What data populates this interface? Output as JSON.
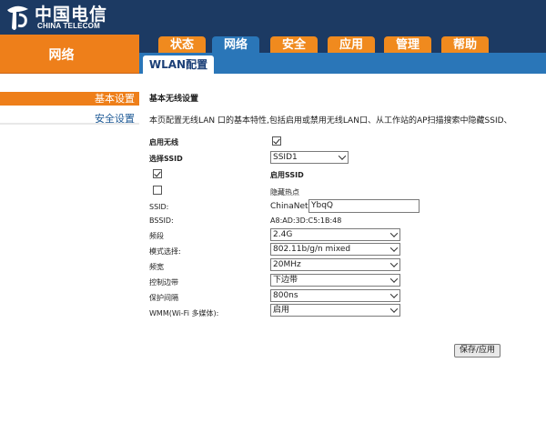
{
  "brand": {
    "name_cn": "中国电信",
    "name_en": "CHINA TELECOM",
    "colors": {
      "header_bg": "#1c3a63",
      "accent_orange": "#ee7f1a",
      "tab_blue": "#2a76b8"
    }
  },
  "nav": {
    "section_label": "网络",
    "tabs": [
      {
        "label": "状态",
        "active": false
      },
      {
        "label": "网络",
        "active": true
      },
      {
        "label": "安全",
        "active": false
      },
      {
        "label": "应用",
        "active": false
      },
      {
        "label": "管理",
        "active": false
      },
      {
        "label": "帮助",
        "active": false
      }
    ],
    "subtab": "WLAN配置"
  },
  "sidebar": {
    "items": [
      {
        "label": "基本设置",
        "active": true
      },
      {
        "label": "安全设置",
        "active": false
      }
    ]
  },
  "main": {
    "title": "基本无线设置",
    "description": "本页配置无线LAN 口的基本特性,包括启用或禁用无线LAN口、从工作站的AP扫描搜索中隐藏SSID、",
    "enable_wireless": {
      "label": "启用无线",
      "checked": true
    },
    "select_ssid": {
      "label": "选择SSID",
      "value": "SSID1"
    },
    "enable_ssid": {
      "label": "启用SSID",
      "checked": true
    },
    "hide_ap": {
      "label": "隐藏热点",
      "checked": false
    },
    "ssid": {
      "label": "SSID:",
      "prefix": "ChinaNet-",
      "value": "YbqQ"
    },
    "bssid": {
      "label": "BSSID:",
      "value": "A8:AD:3D:C5:1B:48"
    },
    "band": {
      "label": "频段",
      "value": "2.4G"
    },
    "mode": {
      "label": "模式选择:",
      "value": "802.11b/g/n mixed"
    },
    "bandwidth": {
      "label": "频宽",
      "value": "20MHz"
    },
    "control_sideband": {
      "label": "控制边带",
      "value": "下边带"
    },
    "guard_interval": {
      "label": "保护间隔",
      "value": "800ns"
    },
    "wmm": {
      "label": "WMM(Wi-Fi 多媒体):",
      "value": "启用"
    },
    "save_label": "保存/应用"
  }
}
